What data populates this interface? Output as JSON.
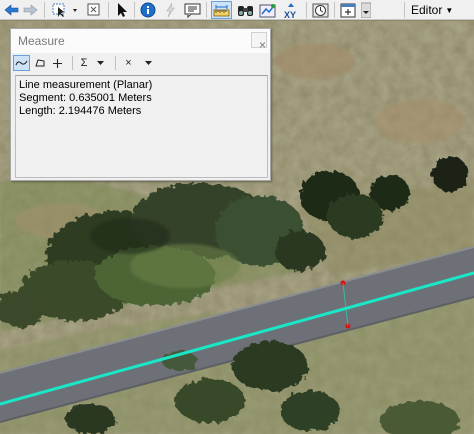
{
  "toolbar": {
    "editor_label": "Editor",
    "tools": [
      "back-arrow-icon",
      "forward-arrow-icon",
      "select-features-icon",
      "clear-selection-icon",
      "select-elements-icon",
      "identify-icon",
      "hyperlink-icon",
      "html-popup-icon",
      "measure-icon",
      "find-icon",
      "find-route-icon",
      "go-to-xy-icon",
      "time-slider-icon",
      "create-viewer-icon",
      "toolbar-options-icon"
    ]
  },
  "measure_window": {
    "title": "Measure",
    "close_glyph": "×",
    "tools": {
      "sum_glyph": "Σ",
      "clear_glyph": "×"
    },
    "output": {
      "line1": "Line measurement (Planar)",
      "line2": "Segment: 0.635001 Meters",
      "line3": "Length: 2.194476 Meters"
    }
  },
  "map": {
    "measure_line_color": "#19e8c8",
    "vertex_color": "#e01010"
  }
}
